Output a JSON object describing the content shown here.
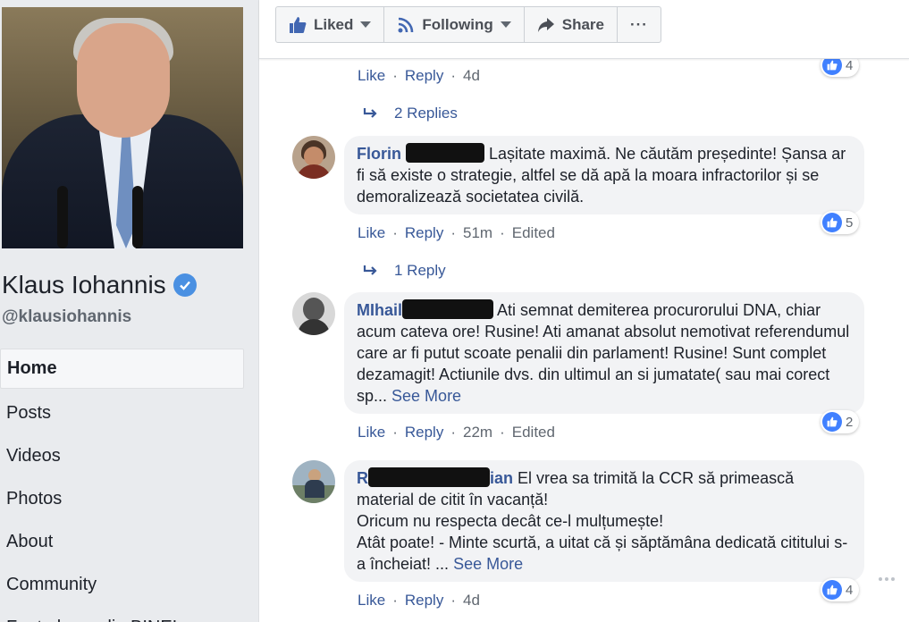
{
  "page": {
    "name": "Klaus Iohannis",
    "handle": "@klausiohannis"
  },
  "nav": {
    "items": [
      "Home",
      "Posts",
      "Videos",
      "Photos",
      "About",
      "Community",
      "Fapte bune din BINE!"
    ]
  },
  "actions": {
    "liked_label": "Liked",
    "following_label": "Following",
    "share_label": "Share",
    "more_label": "···"
  },
  "comments": [
    {
      "meta": {
        "like": "Like",
        "reply": "Reply",
        "time": "4d",
        "edited": ""
      },
      "reactions": "4",
      "replies_link": "2 Replies"
    },
    {
      "author": "Florin",
      "text": "Lașitate maximă. Ne căutăm președinte! Șansa ar fi să existe o strategie, altfel se dă apă la moara infractorilor și se demoralizează societatea civilă.",
      "meta": {
        "like": "Like",
        "reply": "Reply",
        "time": "51m",
        "edited": "Edited"
      },
      "reactions": "5",
      "replies_link": "1 Reply"
    },
    {
      "author": "MIhail",
      "text": "Ati semnat demiterea procurorului DNA, chiar acum cateva ore! Rusine! Ati amanat absolut nemotivat referendumul care ar fi putut scoate penalii din parlament! Rusine! Sunt complet dezamagit! Actiunile dvs. din ultimul an si jumatate( sau mai corect sp...",
      "see_more": "See More",
      "meta": {
        "like": "Like",
        "reply": "Reply",
        "time": "22m",
        "edited": "Edited"
      },
      "reactions": "2"
    },
    {
      "author_start": "R",
      "author_end": "ian",
      "line1": "El vrea sa trimită la CCR să primească material de citit în vacanță!",
      "line2": "Oricum nu respecta decât ce-l mulțumește!",
      "line3": "Atât poate! - Minte scurtă, a uitat că și săptămâna dedicată cititului s-a încheiat! ...",
      "see_more": "See More",
      "meta": {
        "like": "Like",
        "reply": "Reply",
        "time": "4d",
        "edited": ""
      },
      "reactions": "4"
    }
  ]
}
